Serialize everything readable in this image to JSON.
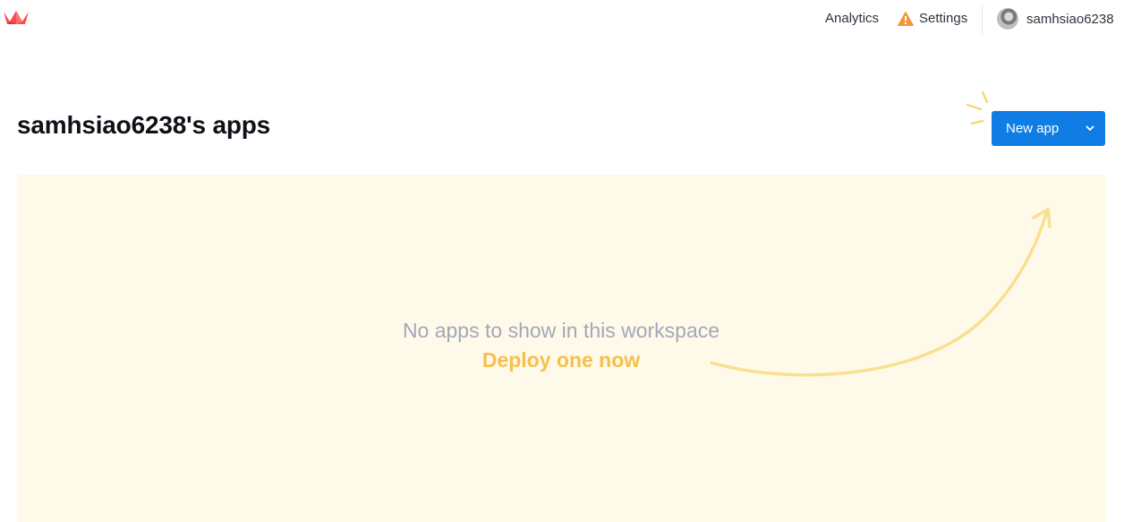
{
  "header": {
    "logo_icon": "streamlit-crown-icon",
    "nav": {
      "analytics": "Analytics",
      "settings": "Settings",
      "settings_icon": "warning-triangle-icon"
    },
    "user": {
      "username": "samhsiao6238",
      "avatar_icon": "avatar"
    }
  },
  "main": {
    "title": "samhsiao6238's apps",
    "new_app_button": {
      "label": "New app",
      "caret_icon": "chevron-down-icon"
    },
    "empty_state": {
      "message": "No apps to show in this workspace",
      "cta": "Deploy one now"
    }
  },
  "colors": {
    "accent": "#0f7de3",
    "brand": "#ff4b4b",
    "warning": "#f79434",
    "panel_bg": "#fff9ea",
    "cta": "#f6c14a",
    "muted_text": "#a3a8b8"
  }
}
